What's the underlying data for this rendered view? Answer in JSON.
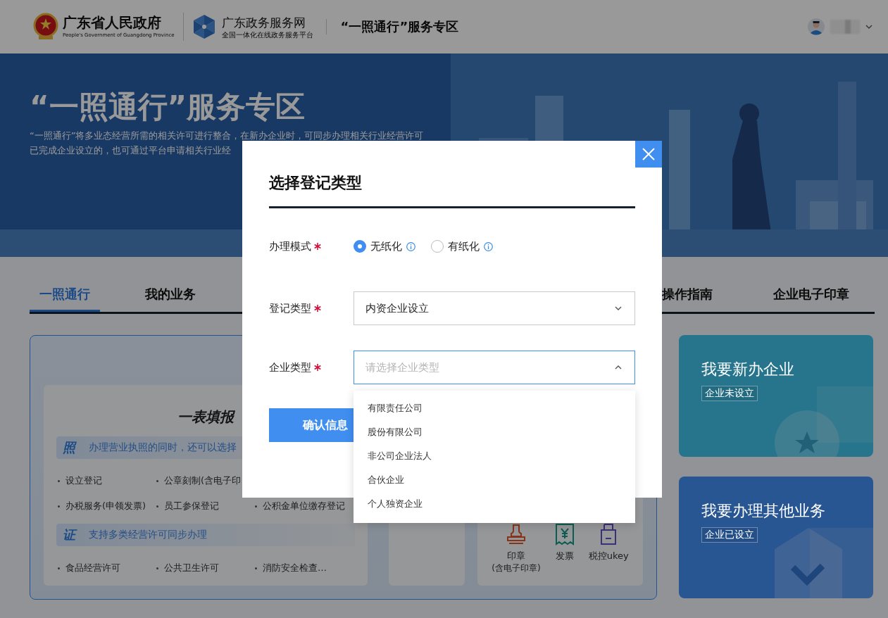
{
  "header": {
    "gov_name": "广东省人民政府",
    "gov_name_en": "People's Government of Guangdong Province",
    "portal_name": "广东政务服务网",
    "portal_subtitle": "全国一体化在线政务服务平台",
    "zone_title": "“一照通行”服务专区"
  },
  "hero": {
    "title": "“一照通行”服务专区",
    "description": [
      "“一照通行”将多业态经营所需的相关许可进行整合，在新办企业时，可同步办理相关行业经营许可",
      "已完成企业设立的，也可通过平台申请相关行业经"
    ]
  },
  "tabs": [
    {
      "label": "一照通行",
      "selected": true
    },
    {
      "label": "我的业务",
      "selected": false
    },
    {
      "label": "操作指南",
      "selected": false
    },
    {
      "label": "企业电子印章",
      "selected": false
    }
  ],
  "form_card": {
    "title": "一表填报",
    "sections": [
      {
        "badge": "照",
        "text": "办理营业执照的同时，还可以选择",
        "rows": [
          [
            "设立登记",
            "公章刻制(含电子印"
          ],
          [
            "办税服务(申领发票)",
            "员工参保登记",
            "公积金单位缴存登记"
          ]
        ]
      },
      {
        "badge": "证",
        "text": "支持多类经营许可同步办理",
        "rows": [
          [
            "食品经营许可",
            "公共卫生许可",
            "消防安全检查…"
          ]
        ]
      }
    ]
  },
  "material_card": {
    "items": [
      {
        "kind": "seal",
        "label": "印章",
        "note": "(含电子印章)"
      },
      {
        "kind": "invoice",
        "label": "发票"
      },
      {
        "kind": "ukey",
        "label": "税控ukey"
      }
    ]
  },
  "entry_cards": [
    {
      "kind": "new",
      "title": "我要新办企业",
      "tag": "企业未设立"
    },
    {
      "kind": "existing",
      "title": "我要办理其他业务",
      "tag": "企业已设立"
    }
  ],
  "dialog": {
    "title": "选择登记类型",
    "mode": {
      "label": "办理模式",
      "required": true,
      "options": [
        {
          "label": "无纸化",
          "selected": true
        },
        {
          "label": "有纸化",
          "selected": false
        }
      ]
    },
    "fields": [
      {
        "label": "登记类型",
        "required": true,
        "value": "内资企业设立",
        "expanded": false
      },
      {
        "label": "企业类型",
        "required": true,
        "placeholder": "请选择企业类型",
        "expanded": true,
        "options": [
          {
            "label": "有限责任公司",
            "selected": false
          },
          {
            "label": "股份有限公司",
            "selected": false
          },
          {
            "label": "非公司企业法人",
            "selected": false
          },
          {
            "label": "合伙企业",
            "selected": false
          },
          {
            "label": "个人独资企业",
            "selected": false
          }
        ]
      }
    ],
    "confirm_button": "确认信息"
  }
}
